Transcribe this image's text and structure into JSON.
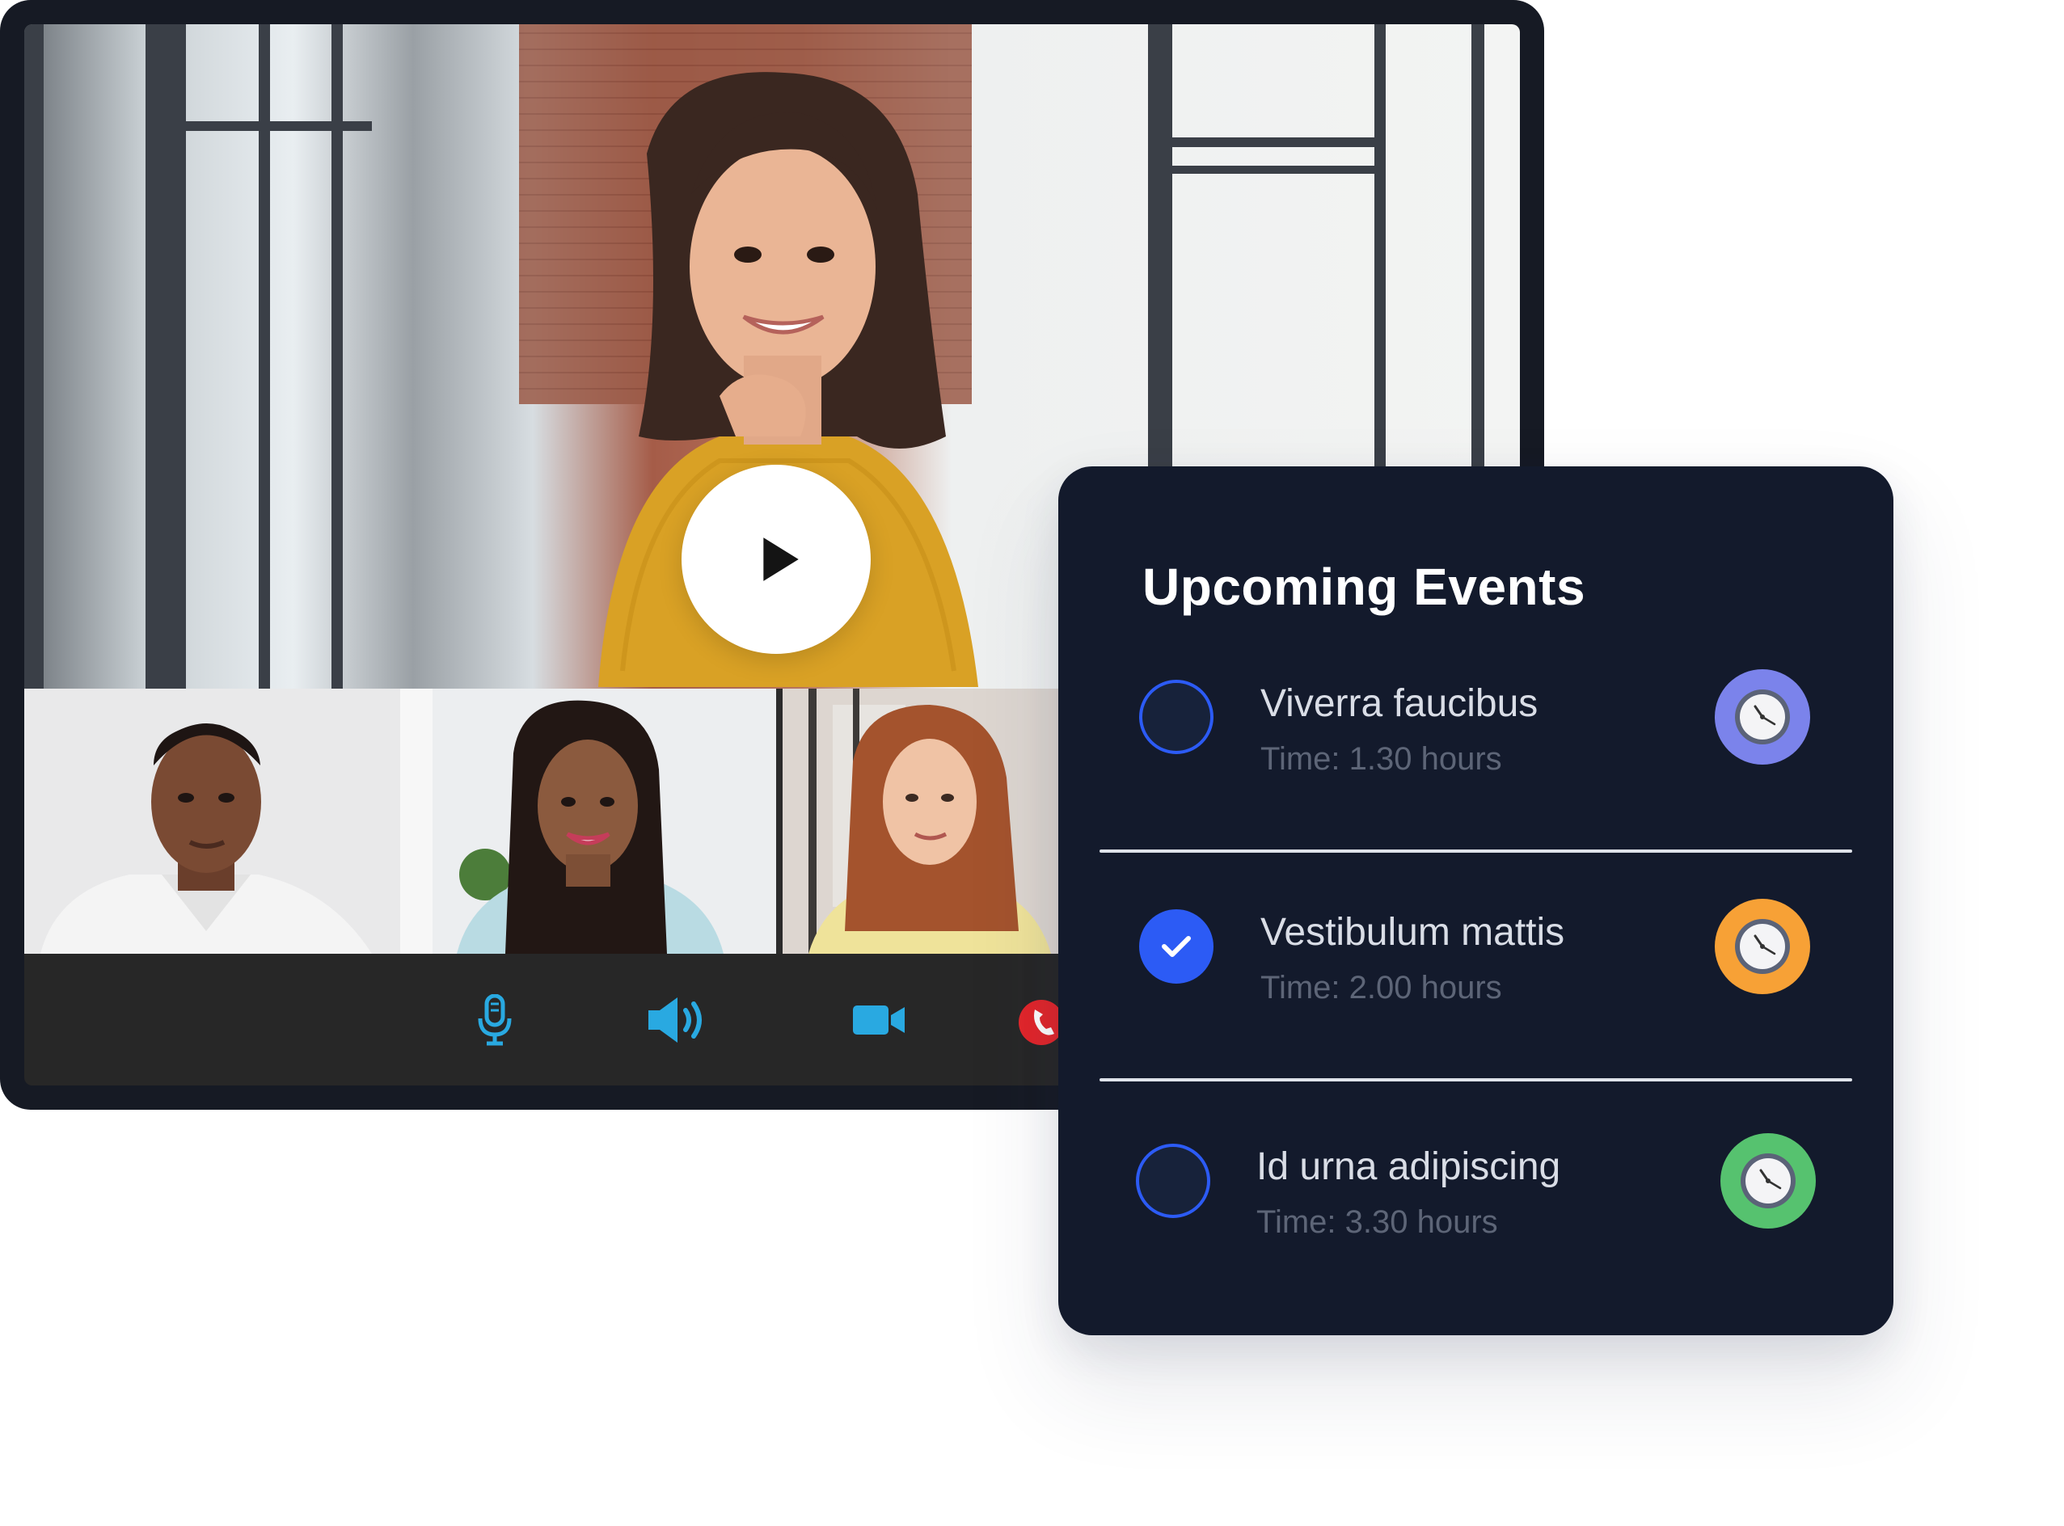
{
  "events_panel": {
    "title": "Upcoming Events",
    "items": [
      {
        "name": "Viverra faucibus",
        "time": "Time: 1.30 hours",
        "completed": false,
        "badge_color": "#7b83eb"
      },
      {
        "name": "Vestibulum mattis",
        "time": "Time: 2.00 hours",
        "completed": true,
        "badge_color": "#f7a136"
      },
      {
        "name": "Id urna adipiscing",
        "time": "Time: 3.30 hours",
        "completed": false,
        "badge_color": "#56c26f"
      }
    ]
  },
  "video_call": {
    "controls": [
      {
        "icon": "microphone-icon",
        "color": "#29a9e1"
      },
      {
        "icon": "speaker-icon",
        "color": "#29a9e1"
      },
      {
        "icon": "video-camera-icon",
        "color": "#29a9e1"
      },
      {
        "icon": "end-call-icon",
        "color": "#e3262b"
      }
    ],
    "play_icon": "play-icon",
    "accent_color": "#2c5bf5"
  }
}
